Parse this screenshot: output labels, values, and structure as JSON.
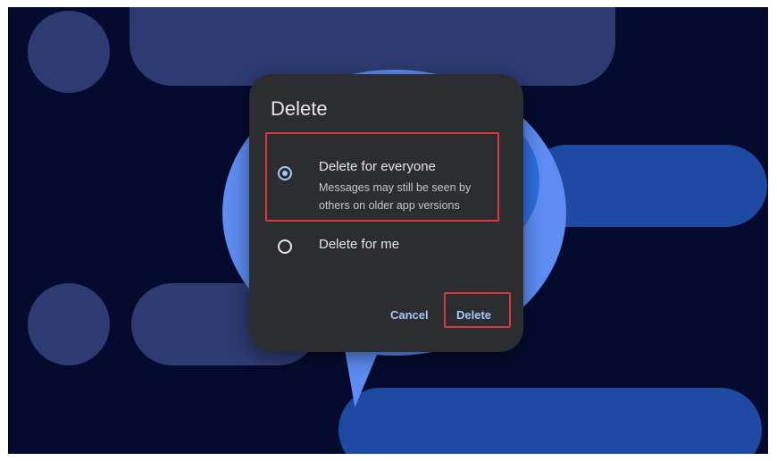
{
  "dialog": {
    "title": "Delete",
    "options": [
      {
        "label": "Delete for everyone",
        "sublabel": "Messages may still be seen by others on older app versions",
        "selected": true
      },
      {
        "label": "Delete for me",
        "selected": false
      }
    ],
    "buttons": {
      "cancel": "Cancel",
      "confirm": "Delete"
    }
  },
  "colors": {
    "background": "#050b2e",
    "dialog": "#2b2d31",
    "accent": "#a8c7fa",
    "highlight": "#d9363e",
    "bubble": "#5e8cf2"
  }
}
